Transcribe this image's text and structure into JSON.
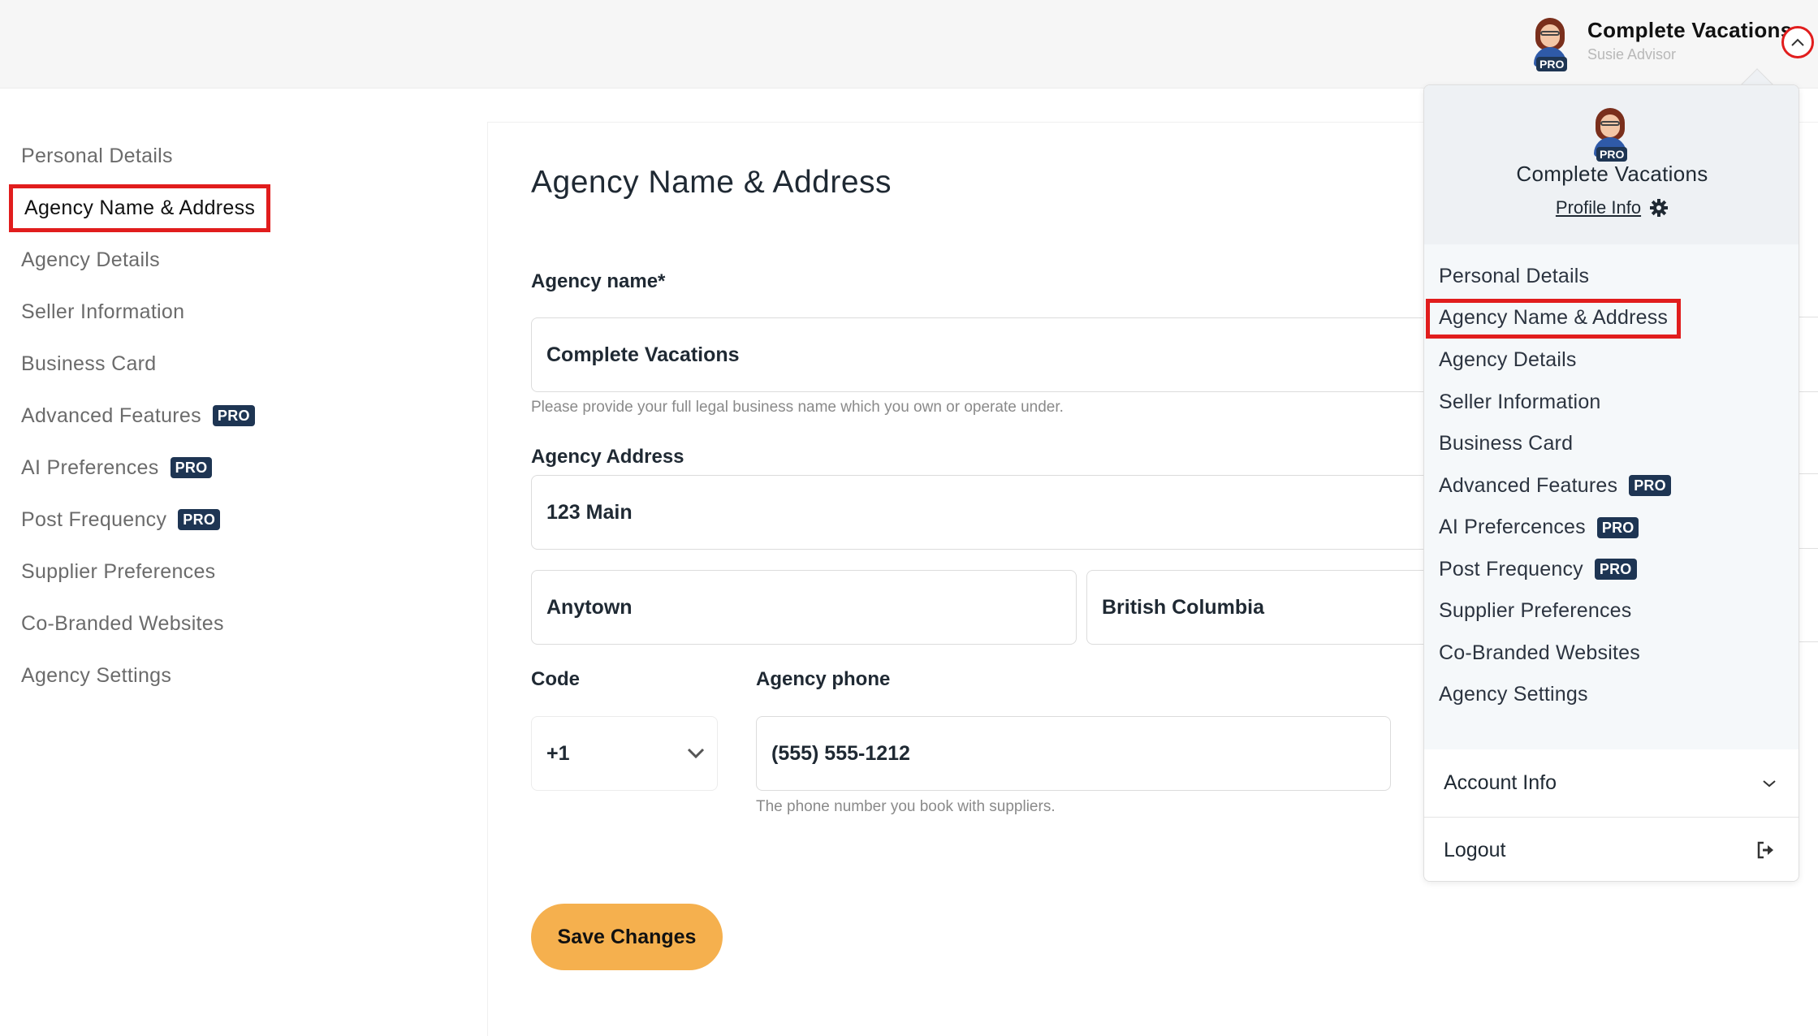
{
  "header": {
    "company_name": "Complete Vacations",
    "user_role": "Susie Advisor",
    "pro_label": "PRO"
  },
  "sidebar": {
    "items": [
      {
        "label": "Personal Details",
        "pro": false,
        "active": false
      },
      {
        "label": "Agency Name & Address",
        "pro": false,
        "active": true
      },
      {
        "label": "Agency Details",
        "pro": false,
        "active": false
      },
      {
        "label": "Seller Information",
        "pro": false,
        "active": false
      },
      {
        "label": "Business Card",
        "pro": false,
        "active": false
      },
      {
        "label": "Advanced Features",
        "pro": true,
        "active": false
      },
      {
        "label": "AI Preferences",
        "pro": true,
        "active": false
      },
      {
        "label": "Post Frequency",
        "pro": true,
        "active": false
      },
      {
        "label": "Supplier Preferences",
        "pro": false,
        "active": false
      },
      {
        "label": "Co-Branded Websites",
        "pro": false,
        "active": false
      },
      {
        "label": "Agency Settings",
        "pro": false,
        "active": false
      }
    ]
  },
  "form": {
    "title": "Agency Name & Address",
    "agency_name_label": "Agency name*",
    "agency_name_value": "Complete Vacations",
    "agency_name_help": "Please provide your full legal business name which you own or operate under.",
    "address_label": "Agency Address",
    "address_line1": "123 Main",
    "city": "Anytown",
    "province": "British Columbia",
    "code_label": "Code",
    "code_value": "+1",
    "phone_label": "Agency phone",
    "phone_value": "(555) 555-1212",
    "phone_help": "The phone number you book with suppliers.",
    "save_label": "Save Changes"
  },
  "dropdown": {
    "company_name": "Complete Vacations",
    "profile_link": "Profile Info",
    "items": [
      {
        "label": "Personal Details",
        "pro": false,
        "active": false
      },
      {
        "label": "Agency Name & Address",
        "pro": false,
        "active": true
      },
      {
        "label": "Agency Details",
        "pro": false,
        "active": false
      },
      {
        "label": "Seller Information",
        "pro": false,
        "active": false
      },
      {
        "label": "Business Card",
        "pro": false,
        "active": false
      },
      {
        "label": "Advanced Features",
        "pro": true,
        "active": false
      },
      {
        "label": "AI Prefercences",
        "pro": true,
        "active": false
      },
      {
        "label": "Post Frequency",
        "pro": true,
        "active": false
      },
      {
        "label": "Supplier Preferences",
        "pro": false,
        "active": false
      },
      {
        "label": "Co-Branded Websites",
        "pro": false,
        "active": false
      },
      {
        "label": "Agency Settings",
        "pro": false,
        "active": false
      }
    ],
    "account_label": "Account Info",
    "logout_label": "Logout"
  },
  "colors": {
    "accent_button": "#f5b04e",
    "pro_badge": "#1e3553",
    "highlight_red": "#e11d1d"
  }
}
